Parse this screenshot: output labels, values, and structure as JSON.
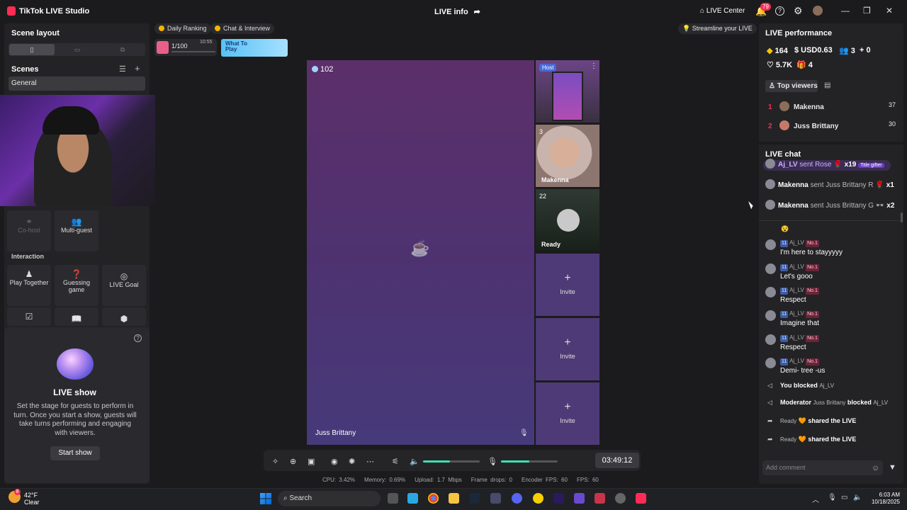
{
  "titlebar": {
    "app_name": "TikTok LIVE Studio",
    "center_title": "LIVE info",
    "live_center_label": "LIVE Center",
    "notification_count": "79"
  },
  "left": {
    "scene_layout_title": "Scene layout",
    "scenes_title": "Scenes",
    "scene_item": "General",
    "cohost_label": "Co-host",
    "multiguest_label": "Multi-guest",
    "interaction_title": "Interaction",
    "tiles": [
      "Play Together",
      "Guessing game",
      "LIVE Goal"
    ],
    "show_title": "LIVE show",
    "show_desc": "Set the stage for guests to perform in turn. Once you start a show, guests will take turns performing and engaging with viewers.",
    "start_show_label": "Start show"
  },
  "top": {
    "chip_daily": "Daily Ranking",
    "chip_chat": "Chat & Interview",
    "rank_value": "1/100",
    "rank_time": "10:55",
    "promo_text": "What To Play",
    "streamline": "Streamline your LIVE"
  },
  "main": {
    "viewer_count": "102",
    "host_name": "Juss Brittany",
    "host_tag": "Host",
    "guest2_count": "3",
    "guest2_name": "Makenna",
    "guest3_count": "22",
    "guest3_name": "Ready",
    "invite_label": "Invite"
  },
  "toolbar": {
    "volume_level": 0.48,
    "mic_level": 0.5,
    "timer": "03:49:12",
    "stats": [
      "CPU: 3.42%",
      "Memory: 0.69%",
      "Upload: 1.7 Mbps",
      "Frame drops: 0",
      "Encoder FPS: 60",
      "FPS: 60"
    ]
  },
  "right": {
    "perf_title": "LIVE performance",
    "diamonds": "164",
    "usd": "USD0.63",
    "users": "3",
    "new_followers": "0",
    "likes": "5.7K",
    "gifts": "4",
    "top_viewers_label": "Top viewers",
    "top_viewers": [
      {
        "rank": "1",
        "name": "Makenna",
        "score": "37"
      },
      {
        "rank": "2",
        "name": "Juss Brittany",
        "score": "30"
      }
    ],
    "chat_title": "LIVE chat",
    "gifts_list": [
      {
        "user": "Aj_LV",
        "text": "sent Rose",
        "count": "x19",
        "tag": "Title gifter"
      },
      {
        "user": "Makenna",
        "text": "sent Juss Brittany R",
        "count": "x1"
      },
      {
        "user": "Makenna",
        "text": "sent Juss Brittany G",
        "count": "x2"
      }
    ],
    "messages": [
      {
        "level": "11",
        "user": "Aj_LV",
        "rank": "No.1",
        "text": "I'm here to stayyyyy"
      },
      {
        "level": "11",
        "user": "Aj_LV",
        "rank": "No.1",
        "text": "Let's gooo"
      },
      {
        "level": "11",
        "user": "Aj_LV",
        "rank": "No.1",
        "text": "Respect"
      },
      {
        "level": "11",
        "user": "Aj_LV",
        "rank": "No.1",
        "text": "Imagine that"
      },
      {
        "level": "11",
        "user": "Aj_LV",
        "rank": "No.1",
        "text": "Respect"
      },
      {
        "level": "11",
        "user": "Aj_LV",
        "rank": "No.1",
        "text": "Demi- tree -us"
      }
    ],
    "sys1_a": "You blocked",
    "sys1_b": "Aj_LV",
    "sys2_a": "Moderator",
    "sys2_b": "Juss Brittany",
    "sys2_c": "blocked",
    "sys2_d": "Aj_LV",
    "share_user": "Ready",
    "share_text": "shared the LIVE",
    "comment_placeholder": "Add comment"
  },
  "taskbar": {
    "temp": "42°F",
    "weather": "Clear",
    "weather_badge": "8",
    "search_label": "Search",
    "time": "6:03 AM",
    "date": "10/18/2025"
  }
}
